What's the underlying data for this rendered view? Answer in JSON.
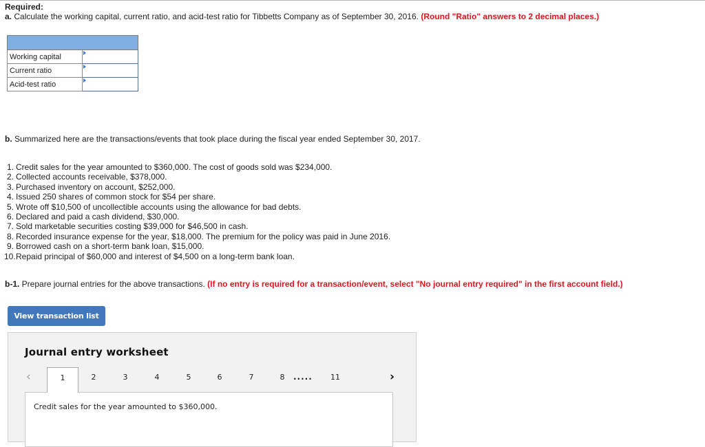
{
  "required_label": "Required:",
  "part_a": {
    "prefix": "a.",
    "text": " Calculate the working capital, current ratio, and acid-test ratio for Tibbetts Company as of September 30, 2016. ",
    "note": "(Round \"Ratio\" answers to 2 decimal places.)"
  },
  "ratio_table": {
    "rows": [
      {
        "label": "Working capital",
        "value": ""
      },
      {
        "label": "Current ratio",
        "value": ""
      },
      {
        "label": "Acid-test ratio",
        "value": ""
      }
    ]
  },
  "part_b": {
    "prefix": "b.",
    "text": " Summarized here are the transactions/events that took place during the fiscal year ended September 30, 2017."
  },
  "transactions": [
    {
      "num": "1.",
      "text": "Credit sales for the year amounted to $360,000. The cost of goods sold was $234,000."
    },
    {
      "num": "2.",
      "text": "Collected accounts receivable, $378,000."
    },
    {
      "num": "3.",
      "text": "Purchased inventory on account, $252,000."
    },
    {
      "num": "4.",
      "text": "Issued 250 shares of common stock for $54 per share."
    },
    {
      "num": "5.",
      "text": "Wrote off $10,500 of uncollectible accounts using the allowance for bad debts."
    },
    {
      "num": "6.",
      "text": "Declared and paid a cash dividend, $30,000."
    },
    {
      "num": "7.",
      "text": "Sold marketable securities costing $39,000 for $46,500 in cash."
    },
    {
      "num": "8.",
      "text": "Recorded insurance expense for the year, $18,000. The premium for the policy was paid in June 2016."
    },
    {
      "num": "9.",
      "text": "Borrowed cash on a short-term bank loan, $15,000."
    },
    {
      "num": "10.",
      "text": "Repaid principal of $60,000 and interest of $4,500 on a long-term bank loan."
    }
  ],
  "part_b1": {
    "prefix": "b-1.",
    "text": " Prepare journal entries for the above transactions. ",
    "note": "(If no entry is required for a transaction/event, select \"No journal entry required\" in the first account field.)"
  },
  "view_button_label": "View transaction list",
  "worksheet": {
    "title": "Journal entry worksheet",
    "prev_icon": "‹",
    "next_icon": "›",
    "tabs": [
      "1",
      "2",
      "3",
      "4",
      "5",
      "6",
      "7",
      "8"
    ],
    "ellipsis": ".....",
    "last_tab": "11",
    "active_tab": "1",
    "description": "Credit sales for the year amounted to $360,000."
  },
  "colors": {
    "accent_red": "#e0141e",
    "button_blue": "#4377bc",
    "table_header_blue": "#7eaee2"
  }
}
